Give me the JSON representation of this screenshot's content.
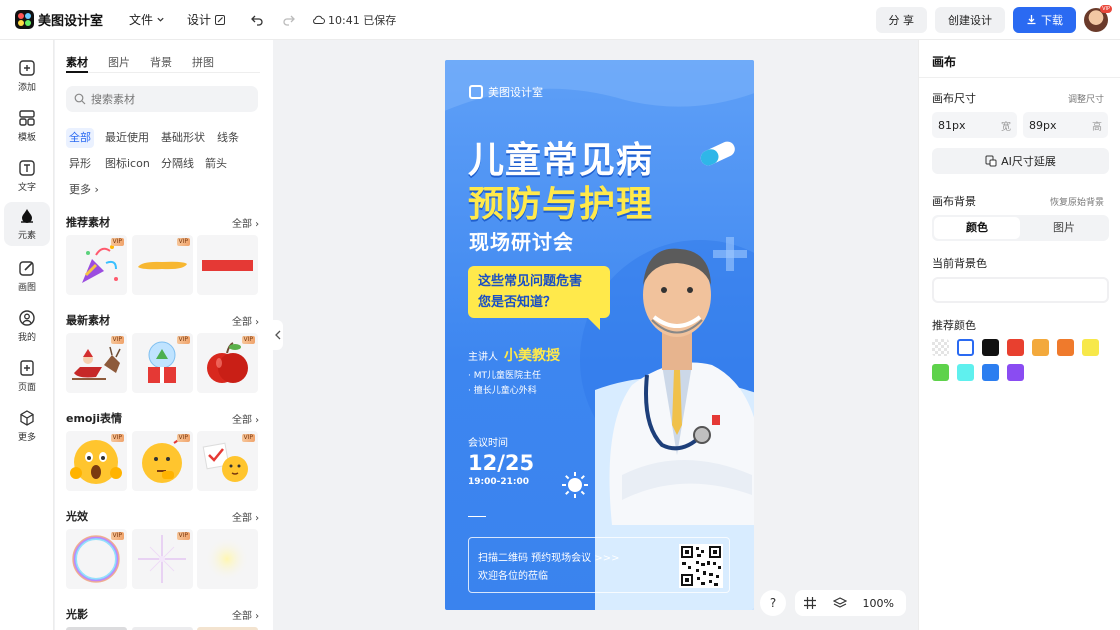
{
  "app": {
    "name": "美图设计室"
  },
  "toolbar": {
    "file_label": "文件",
    "design_label": "设计",
    "saved_text": "10:41 已保存",
    "share_label": "分 享",
    "create_label": "创建设计",
    "download_label": "下载",
    "avatar_badge": "VIP"
  },
  "leftnav": {
    "items": [
      {
        "label": "添加",
        "icon": "plus-square-icon"
      },
      {
        "label": "模板",
        "icon": "template-icon"
      },
      {
        "label": "文字",
        "icon": "text-icon"
      },
      {
        "label": "元素",
        "icon": "element-icon"
      },
      {
        "label": "画图",
        "icon": "draw-icon"
      },
      {
        "label": "我的",
        "icon": "user-icon"
      },
      {
        "label": "页面",
        "icon": "page-icon"
      },
      {
        "label": "更多",
        "icon": "cube-icon"
      }
    ],
    "active": "元素"
  },
  "panel": {
    "tabs": [
      "素材",
      "图片",
      "背景",
      "拼图"
    ],
    "active_tab": "素材",
    "search_placeholder": "搜索素材",
    "chips": [
      "全部",
      "最近使用",
      "基础形状",
      "线条",
      "异形",
      "图标icon",
      "分隔线",
      "箭头",
      "更多"
    ],
    "active_chip": "全部",
    "all_label": "全部",
    "vip_label": "VIP",
    "sections": [
      {
        "title": "推荐素材",
        "thumbs": [
          "party-popper",
          "yellow-brush-stroke",
          "red-bar"
        ]
      },
      {
        "title": "最新素材",
        "thumbs": [
          "santa-sleigh",
          "snow-globe-gift",
          "red-apple"
        ]
      },
      {
        "title": "emoji表情",
        "thumbs": [
          "shocked-emoji",
          "thinking-emoji",
          "checklist-emoji"
        ]
      },
      {
        "title": "光效",
        "thumbs": [
          "rainbow-ring",
          "sparkle-star",
          "soft-glow"
        ]
      },
      {
        "title": "光影",
        "thumbs": []
      }
    ]
  },
  "poster": {
    "brand": "美图设计室",
    "title_line1": "儿童常见病",
    "title_line2": "预防与护理",
    "subtitle": "现场研讨会",
    "question_line1": "这些常见问题危害",
    "question_line2": "您是否知道？",
    "speaker_label": "主讲人",
    "speaker_name": "小美教授",
    "bullet1": "· MT儿童医院主任",
    "bullet2": "· 擅长儿童心外科",
    "meeting_label": "会议时间",
    "meeting_date": "12/25",
    "meeting_time": "19:00-21:00",
    "qr_line1": "扫描二维码 预约现场会议 >>>",
    "qr_line2": "欢迎各位的莅临"
  },
  "canvas_toolbar": {
    "help": "?",
    "zoom": "100%"
  },
  "rightpanel": {
    "title": "画布",
    "size_label": "画布尺寸",
    "adjust_size": "调整尺寸",
    "width_value": "81px",
    "width_unit": "宽",
    "height_value": "89px",
    "height_unit": "高",
    "ai_extend": "AI尺寸延展",
    "bg_label": "画布背景",
    "restore_bg": "恢复原始背景",
    "seg_color": "颜色",
    "seg_image": "图片",
    "current_bg": "当前背景色",
    "recommended": "推荐颜色",
    "swatches": [
      "transparent",
      "#ffffff",
      "#111111",
      "#e8402f",
      "#f3a93c",
      "#ef7a2c",
      "#f7e84a",
      "#5ed24b",
      "#5ff0ee",
      "#2c7ef0",
      "#8a4cf2"
    ]
  },
  "colors": {
    "accent": "#2a6af2",
    "poster_bg": "#3d86f0",
    "poster_yellow": "#ffe94b"
  }
}
